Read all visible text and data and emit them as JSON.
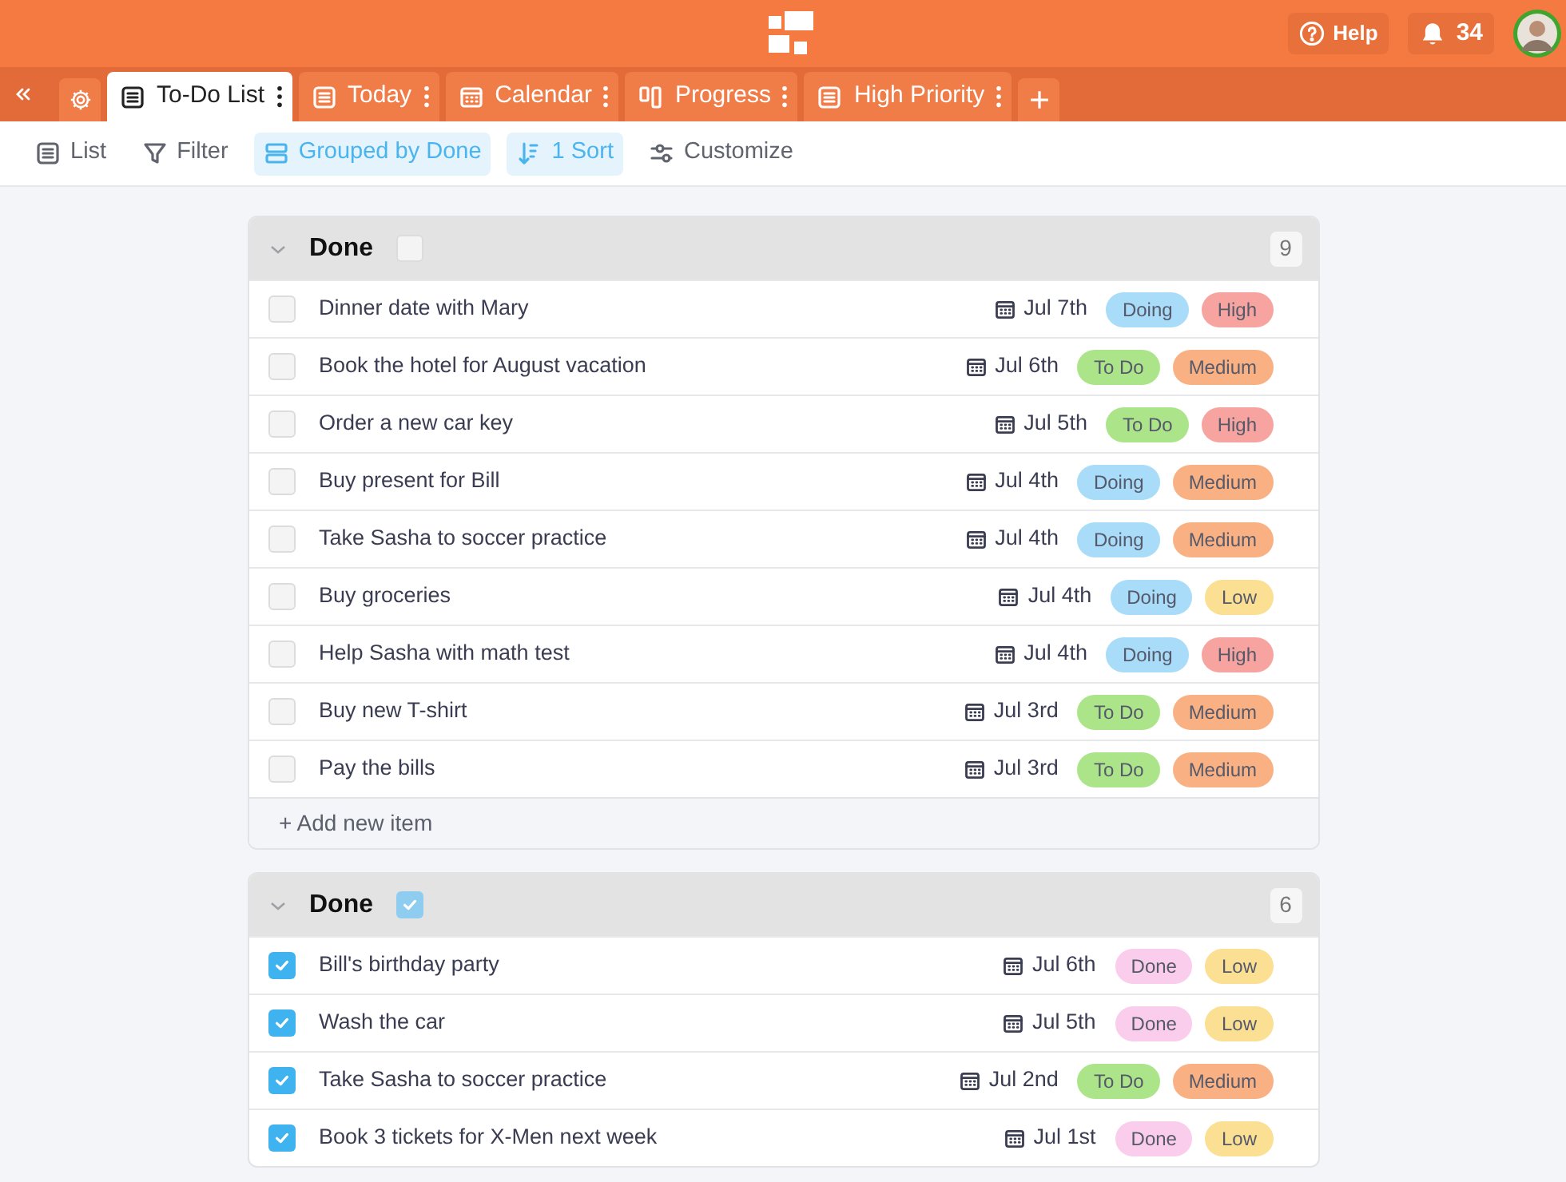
{
  "header": {
    "help": "Help",
    "notifications": "34"
  },
  "tabs": [
    {
      "label": "To-Do List",
      "kind": "list",
      "selected": true
    },
    {
      "label": "Today",
      "kind": "list",
      "selected": false
    },
    {
      "label": "Calendar",
      "kind": "calendar",
      "selected": false
    },
    {
      "label": "Progress",
      "kind": "board",
      "selected": false
    },
    {
      "label": "High Priority",
      "kind": "list",
      "selected": false
    }
  ],
  "toolbar": [
    {
      "label": "List",
      "kind": "list",
      "active": false
    },
    {
      "label": "Filter",
      "kind": "filter",
      "active": false
    },
    {
      "label": "Grouped by Done",
      "kind": "group",
      "active": true
    },
    {
      "label": "1 Sort",
      "kind": "sort",
      "active": true
    },
    {
      "label": "Customize",
      "kind": "sliders",
      "active": false
    }
  ],
  "groups": [
    {
      "title": "Done",
      "checked": false,
      "count": "9",
      "add_label": "+ Add new item",
      "rows": [
        {
          "title": "Dinner date with Mary",
          "checked": false,
          "date": "Jul 7th",
          "status": {
            "label": "Doing",
            "color": "#a8dcf8"
          },
          "priority": {
            "label": "High",
            "color": "#f7a3a0"
          }
        },
        {
          "title": "Book the hotel for August vacation",
          "checked": false,
          "date": "Jul 6th",
          "status": {
            "label": "To Do",
            "color": "#ace589"
          },
          "priority": {
            "label": "Medium",
            "color": "#f9b184"
          }
        },
        {
          "title": "Order a new car key",
          "checked": false,
          "date": "Jul 5th",
          "status": {
            "label": "To Do",
            "color": "#ace589"
          },
          "priority": {
            "label": "High",
            "color": "#f7a3a0"
          }
        },
        {
          "title": "Buy present for Bill",
          "checked": false,
          "date": "Jul 4th",
          "status": {
            "label": "Doing",
            "color": "#a8dcf8"
          },
          "priority": {
            "label": "Medium",
            "color": "#f9b184"
          }
        },
        {
          "title": "Take Sasha to soccer practice",
          "checked": false,
          "date": "Jul 4th",
          "status": {
            "label": "Doing",
            "color": "#a8dcf8"
          },
          "priority": {
            "label": "Medium",
            "color": "#f9b184"
          }
        },
        {
          "title": "Buy groceries",
          "checked": false,
          "date": "Jul 4th",
          "status": {
            "label": "Doing",
            "color": "#a8dcf8"
          },
          "priority": {
            "label": "Low",
            "color": "#fbdf92"
          }
        },
        {
          "title": "Help Sasha with math test",
          "checked": false,
          "date": "Jul 4th",
          "status": {
            "label": "Doing",
            "color": "#a8dcf8"
          },
          "priority": {
            "label": "High",
            "color": "#f7a3a0"
          }
        },
        {
          "title": "Buy new T-shirt",
          "checked": false,
          "date": "Jul 3rd",
          "status": {
            "label": "To Do",
            "color": "#ace589"
          },
          "priority": {
            "label": "Medium",
            "color": "#f9b184"
          }
        },
        {
          "title": "Pay the bills",
          "checked": false,
          "date": "Jul 3rd",
          "status": {
            "label": "To Do",
            "color": "#ace589"
          },
          "priority": {
            "label": "Medium",
            "color": "#f9b184"
          }
        }
      ]
    },
    {
      "title": "Done",
      "checked": true,
      "count": "6",
      "rows": [
        {
          "title": "Bill's birthday party",
          "checked": true,
          "date": "Jul 6th",
          "status": {
            "label": "Done",
            "color": "#fbcdec"
          },
          "priority": {
            "label": "Low",
            "color": "#fbdf92"
          }
        },
        {
          "title": "Wash the car",
          "checked": true,
          "date": "Jul 5th",
          "status": {
            "label": "Done",
            "color": "#fbcdec"
          },
          "priority": {
            "label": "Low",
            "color": "#fbdf92"
          }
        },
        {
          "title": "Take Sasha to soccer practice",
          "checked": true,
          "date": "Jul 2nd",
          "status": {
            "label": "To Do",
            "color": "#ace589"
          },
          "priority": {
            "label": "Medium",
            "color": "#f9b184"
          }
        },
        {
          "title": "Book 3 tickets for X-Men next week",
          "checked": true,
          "date": "Jul 1st",
          "status": {
            "label": "Done",
            "color": "#fbcdec"
          },
          "priority": {
            "label": "Low",
            "color": "#fbdf92"
          }
        }
      ]
    }
  ]
}
